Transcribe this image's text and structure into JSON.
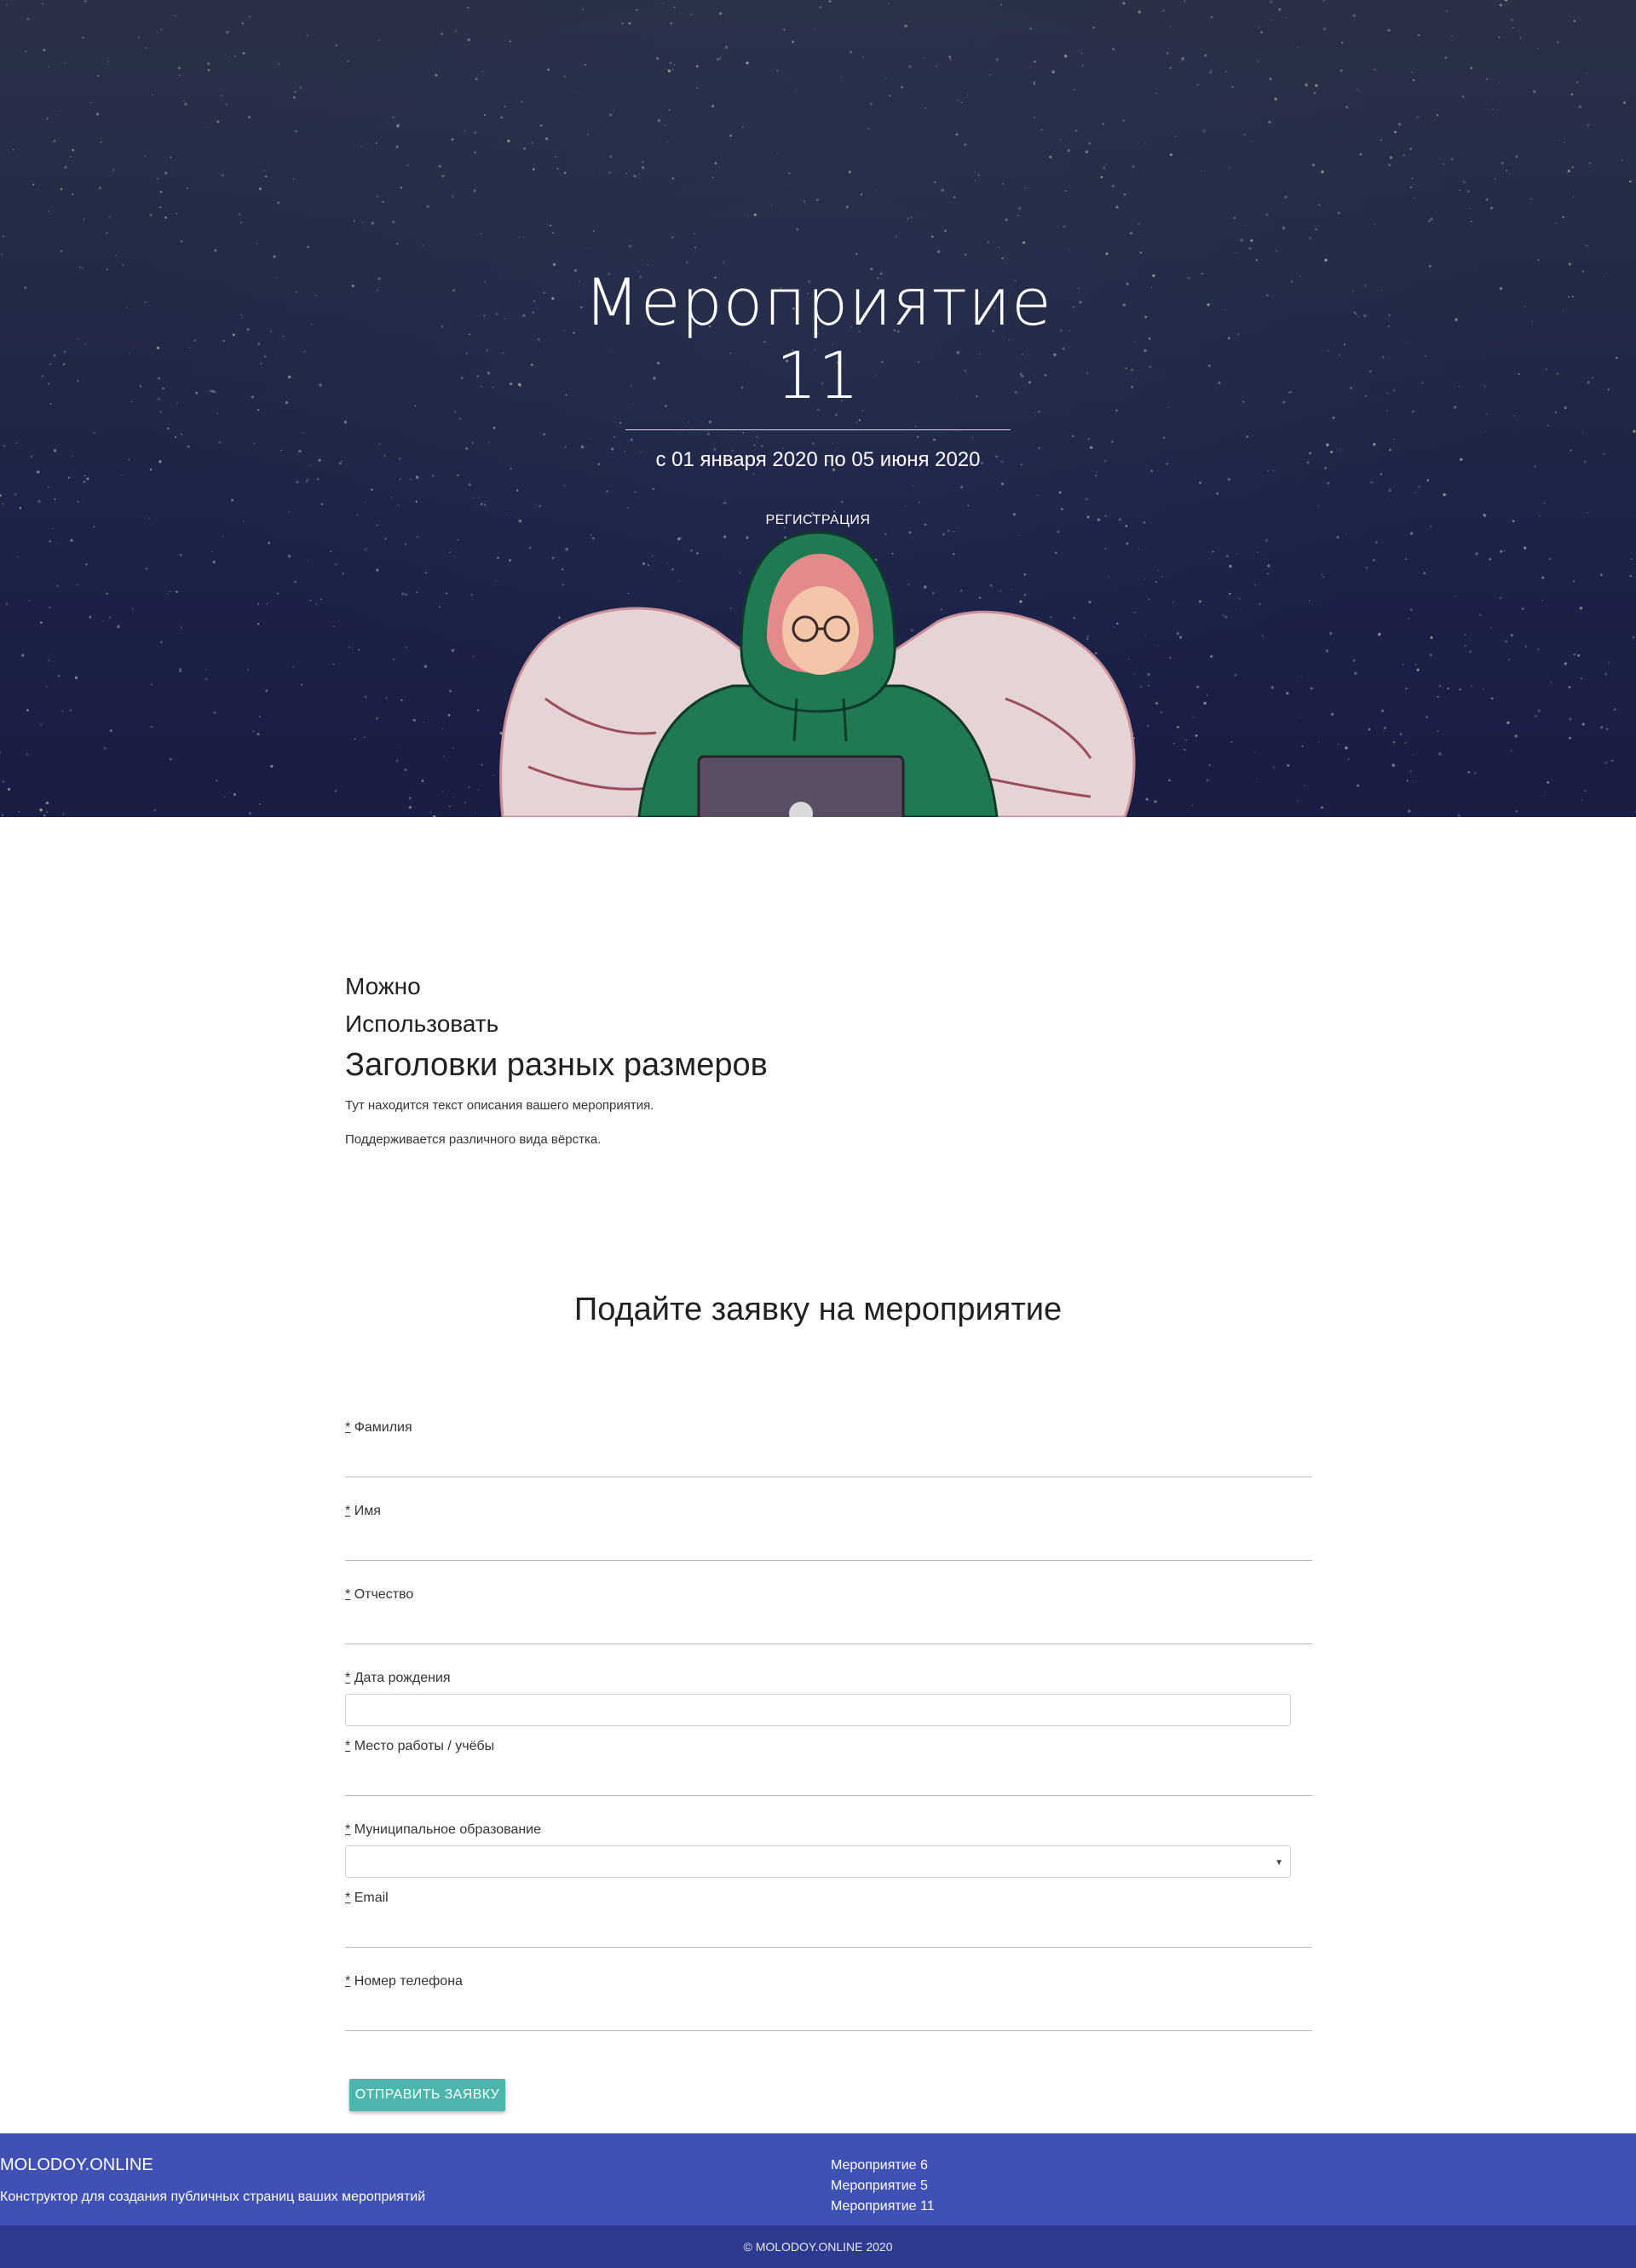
{
  "hero": {
    "title_line1": "Мероприятие",
    "title_line2": "11",
    "dates": "с 01 января 2020 по 05 июня 2020",
    "register_label": "РЕГИСТРАЦИЯ"
  },
  "about": {
    "heading1": "Можно",
    "heading2": "Использовать",
    "heading3": "Заголовки разных размеров",
    "text1": "Тут находится текст описания вашего мероприятия.",
    "text2": "Поддерживается различного вида вёрстка."
  },
  "form": {
    "title": "Подайте заявку на мероприятие",
    "required_mark": "*",
    "fields": {
      "last_name": "Фамилия",
      "first_name": "Имя",
      "patronymic": "Отчество",
      "birth_date": "Дата рождения",
      "workplace": "Место работы / учёбы",
      "municipality": "Муниципальное образование",
      "email": "Email",
      "phone": "Номер телефона"
    },
    "submit_label": "ОТПРАВИТЬ ЗАЯВКУ"
  },
  "footer": {
    "brand": "MOLODOY.ONLINE",
    "description": "Конструктор для создания публичных страниц ваших мероприятий",
    "links": [
      "Мероприятие 6",
      "Мероприятие 5",
      "Мероприятие 11"
    ],
    "copyright": "© MOLODOY.ONLINE 2020"
  },
  "colors": {
    "hero_bg": "#1c2148",
    "footer_bg": "#3f51b5",
    "footer_bottom_bg": "#2e3a8f",
    "submit_bg": "#4db6ac"
  }
}
